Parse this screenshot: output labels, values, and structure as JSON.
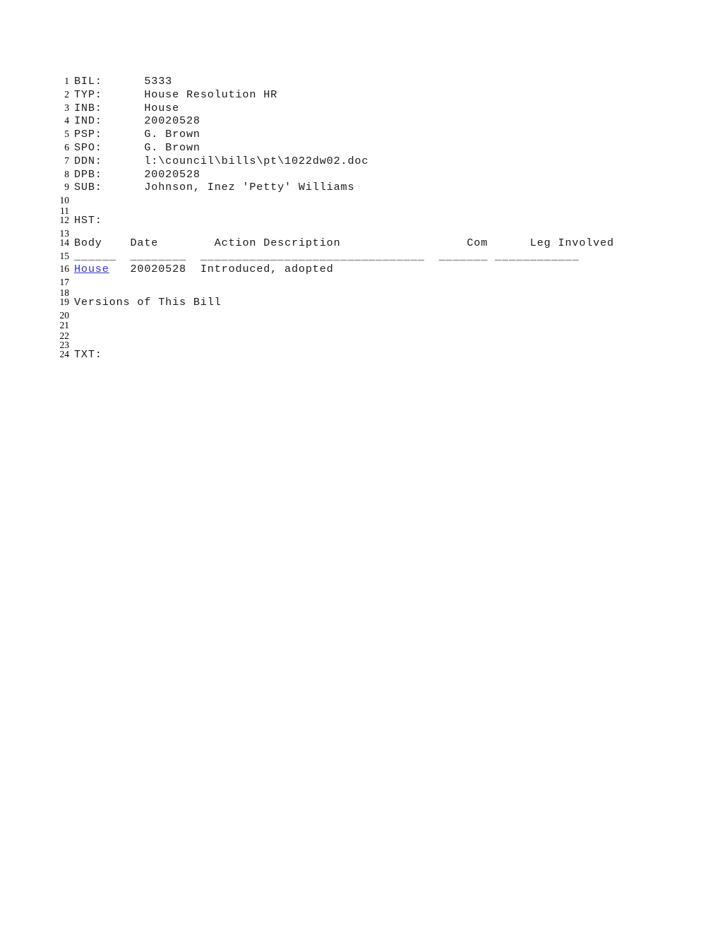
{
  "document": {
    "type": "legislative-bill-record",
    "fields": [
      {
        "line": 1,
        "label": "BIL:",
        "value": "5333"
      },
      {
        "line": 2,
        "label": "TYP:",
        "value": "House Resolution HR"
      },
      {
        "line": 3,
        "label": "INB:",
        "value": "House"
      },
      {
        "line": 4,
        "label": "IND:",
        "value": "20020528"
      },
      {
        "line": 5,
        "label": "PSP:",
        "value": "G. Brown"
      },
      {
        "line": 6,
        "label": "SPO:",
        "value": "G. Brown"
      },
      {
        "line": 7,
        "label": "DDN:",
        "value": "l:\\council\\bills\\pt\\1022dw02.doc"
      },
      {
        "line": 8,
        "label": "DPB:",
        "value": "20020528"
      },
      {
        "line": 9,
        "label": "SUB:",
        "value": "Johnson, Inez 'Petty' Williams"
      }
    ],
    "history": {
      "label": "HST:",
      "label_line": 12,
      "header_line": 14,
      "rule_line": 15,
      "header": {
        "body": "Body",
        "date": "Date",
        "action": "Action Description",
        "com": "Com",
        "leg": "Leg Involved"
      },
      "rule": {
        "body": "______",
        "date": "________",
        "action": "________________________________",
        "com": "_______",
        "leg": "____________"
      },
      "rows": [
        {
          "line": 16,
          "body": "House",
          "body_is_link": true,
          "date": "20020528",
          "action": "Introduced, adopted",
          "com": "",
          "leg": ""
        }
      ]
    },
    "versions_heading": {
      "line": 19,
      "text": "Versions of This Bill"
    },
    "text_section": {
      "line": 24,
      "label": "TXT:"
    },
    "line_numbers": [
      1,
      2,
      3,
      4,
      5,
      6,
      7,
      8,
      9,
      10,
      11,
      12,
      13,
      14,
      15,
      16,
      17,
      18,
      19,
      20,
      21,
      22,
      23,
      24
    ],
    "blank_lines": [
      10,
      11,
      13,
      17,
      18,
      20,
      21,
      22,
      23
    ],
    "colors": {
      "page_background": "#ffffff",
      "body_text": "#1a1a1a",
      "line_number": "#000000",
      "link": "#3333cc"
    }
  }
}
